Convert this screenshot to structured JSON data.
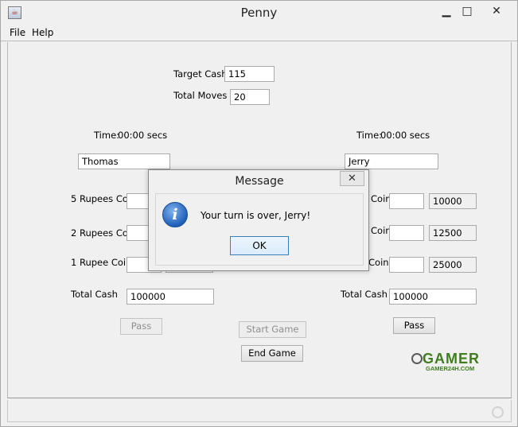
{
  "window": {
    "title": "Penny",
    "minimize": "▁",
    "maximize": "□",
    "close": "✕"
  },
  "menu": {
    "file": "File",
    "help": "Help"
  },
  "target_cash": {
    "label": "Target Cash",
    "value": "115"
  },
  "total_moves": {
    "label": "Total Moves",
    "value": "20"
  },
  "player1": {
    "time_label": "Time:",
    "time_value": "00:00 secs",
    "name": "Thomas",
    "coin5_label": "5 Rupees Coin",
    "coin2_label": "2 Rupees Coin",
    "coin1_label": "1 Rupee Coin",
    "total_label": "Total Cash",
    "total_value": "100000",
    "pass": "Pass"
  },
  "player2": {
    "time_label": "Time:",
    "time_value": "00:00 secs",
    "name": "Jerry",
    "coin5_label": "Coin",
    "coin5_value": "10000",
    "coin2_label": "Coin",
    "coin2_value": "12500",
    "coin1_label": "Coin",
    "coin1_value": "25000",
    "total_label": "Total Cash",
    "total_value": "100000",
    "pass": "Pass"
  },
  "start_game": "Start Game",
  "end_game": "End Game",
  "logo": {
    "main": "GAMER",
    "sub": "GAMER24H.COM"
  },
  "dialog": {
    "title": "Message",
    "close": "✕",
    "icon_glyph": "i",
    "message": "Your turn is over, Jerry!",
    "ok": "OK"
  },
  "colors": {
    "dialog_ok_border": "#3c7fb1",
    "info_icon": "#1f5fb8",
    "logo_green": "#3f7d1e"
  }
}
